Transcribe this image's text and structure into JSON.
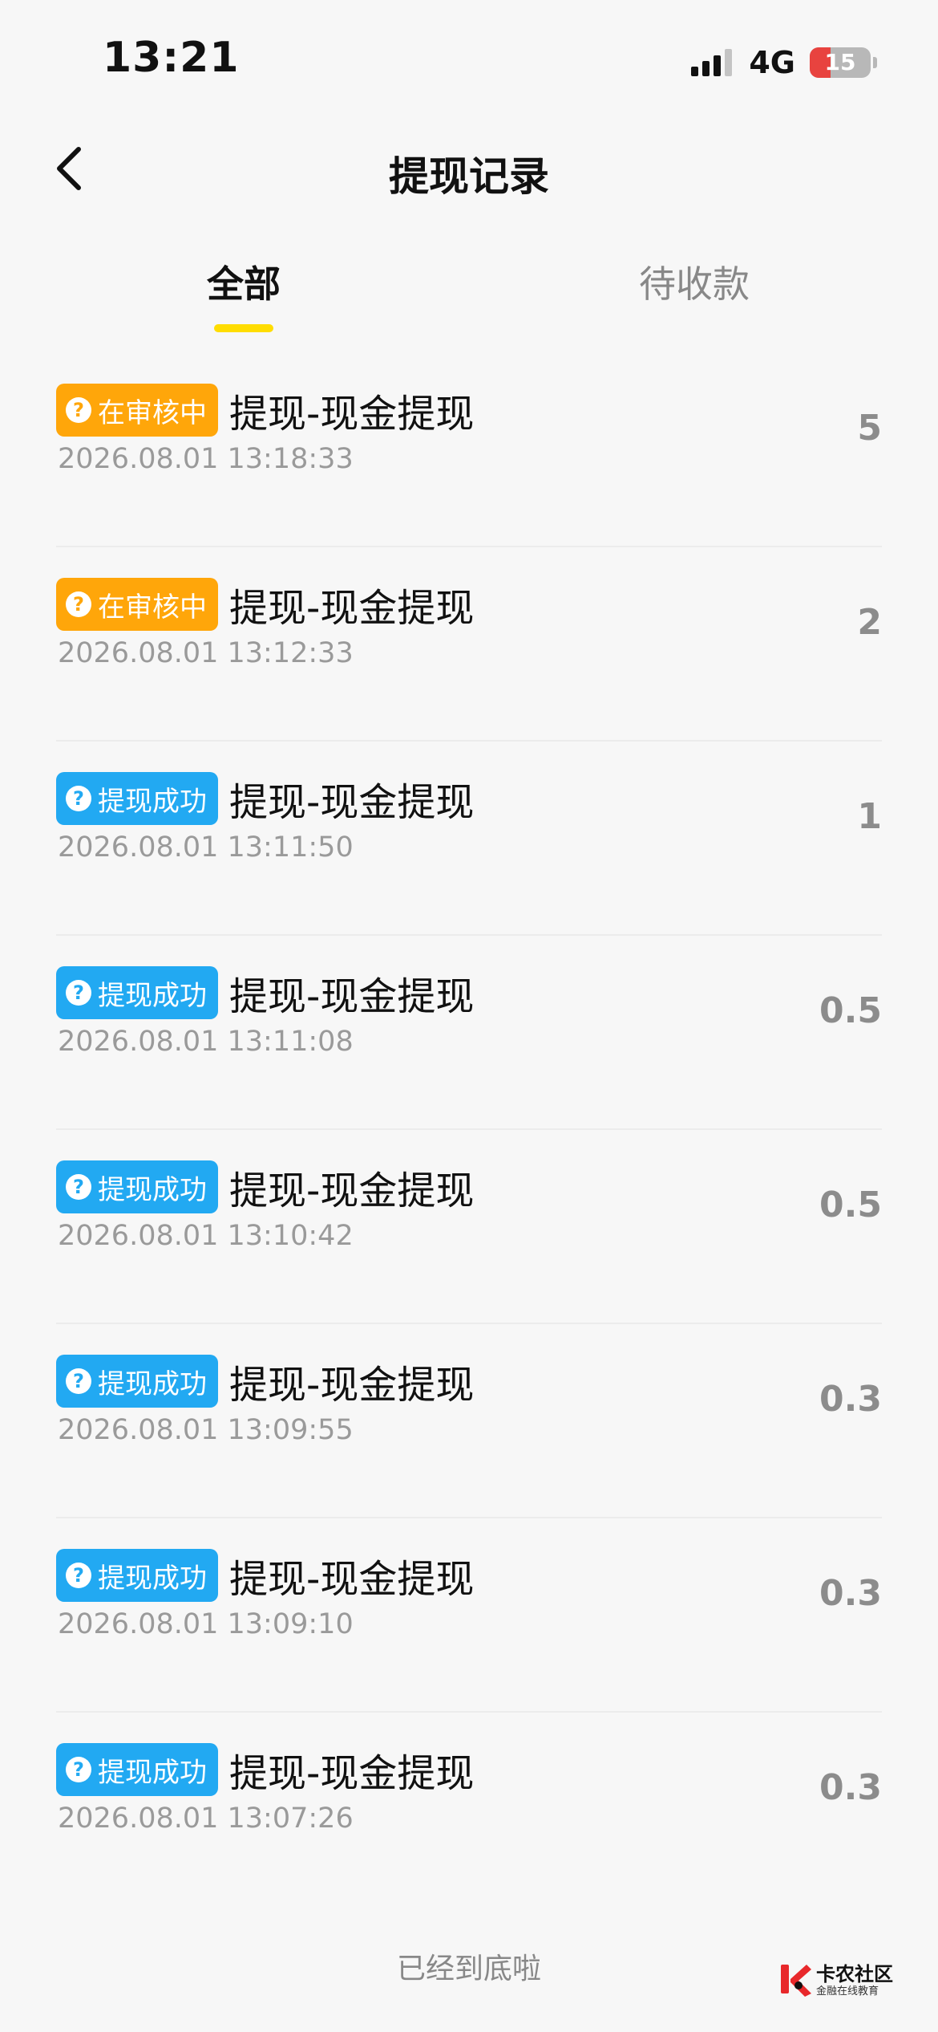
{
  "status_bar": {
    "time": "13:21",
    "network": "4G",
    "battery_level": "15",
    "battery_fraction": 0.15,
    "signal_bars": 3,
    "signal_icon": "cellular-signal-icon",
    "battery_icon": "battery-icon"
  },
  "nav": {
    "title": "提现记录",
    "back_icon": "chevron-left-icon"
  },
  "tabs": [
    {
      "label": "全部",
      "active": true
    },
    {
      "label": "待收款",
      "active": false
    }
  ],
  "colors": {
    "accent": "#ffdd00",
    "pending_badge": "#ffa60a",
    "success_badge": "#22a9f2",
    "amount": "#8c8c8c"
  },
  "records": [
    {
      "status": "在审核中",
      "status_type": "pending",
      "title": "提现-现金提现",
      "time": "2026.08.01 13:18:33",
      "amount": "5"
    },
    {
      "status": "在审核中",
      "status_type": "pending",
      "title": "提现-现金提现",
      "time": "2026.08.01 13:12:33",
      "amount": "2"
    },
    {
      "status": "提现成功",
      "status_type": "success",
      "title": "提现-现金提现",
      "time": "2026.08.01 13:11:50",
      "amount": "1"
    },
    {
      "status": "提现成功",
      "status_type": "success",
      "title": "提现-现金提现",
      "time": "2026.08.01 13:11:08",
      "amount": "0.5"
    },
    {
      "status": "提现成功",
      "status_type": "success",
      "title": "提现-现金提现",
      "time": "2026.08.01 13:10:42",
      "amount": "0.5"
    },
    {
      "status": "提现成功",
      "status_type": "success",
      "title": "提现-现金提现",
      "time": "2026.08.01 13:09:55",
      "amount": "0.3"
    },
    {
      "status": "提现成功",
      "status_type": "success",
      "title": "提现-现金提现",
      "time": "2026.08.01 13:09:10",
      "amount": "0.3"
    },
    {
      "status": "提现成功",
      "status_type": "success",
      "title": "提现-现金提现",
      "time": "2026.08.01 13:07:26",
      "amount": "0.3"
    }
  ],
  "footer": {
    "end_text": "已经到底啦"
  },
  "watermark": {
    "title": "卡农社区",
    "subtitle": "金融在线教育",
    "icon": "kanong-logo-icon"
  }
}
